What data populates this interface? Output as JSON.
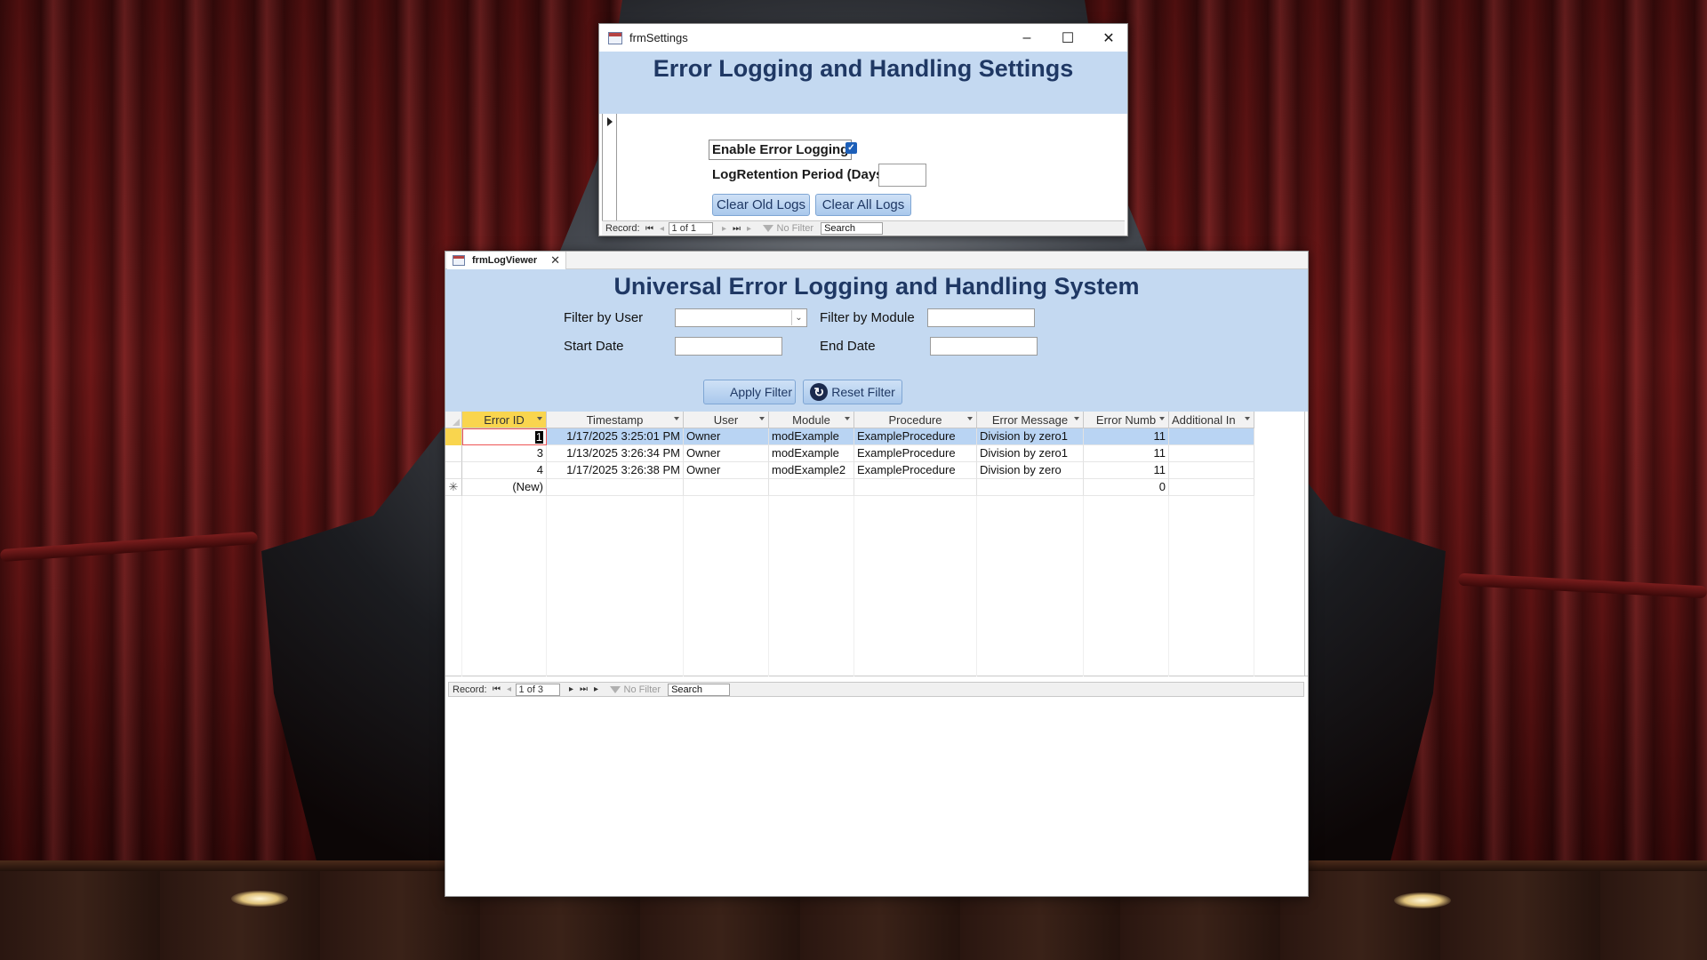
{
  "settings": {
    "window_title": "frmSettings",
    "header_title": "Error Logging and Handling Settings",
    "enable_label": "Enable Error Logging",
    "enable_checked": true,
    "retention_label": "LogRetention Period (Days)",
    "retention_value": "",
    "clear_old_label": "Clear Old Logs",
    "clear_all_label": "Clear All Logs",
    "nav": {
      "record_label": "Record:",
      "record_value": "1 of 1",
      "filter_label": "No Filter",
      "search_label": "Search"
    }
  },
  "viewer": {
    "tab_title": "frmLogViewer",
    "header_title": "Universal Error Logging and Handling System",
    "filter_user_label": "Filter by User",
    "filter_module_label": "Filter by Module",
    "start_date_label": "Start Date",
    "end_date_label": "End Date",
    "apply_label": "Apply Filter",
    "reset_label": "Reset Filter",
    "columns": [
      "Error ID",
      "Timestamp",
      "User",
      "Module",
      "Procedure",
      "Error Message",
      "Error Numb",
      "Additional In"
    ],
    "rows": [
      {
        "id": "1",
        "timestamp": "1/17/2025 3:25:01 PM",
        "user": "Owner",
        "module": "modExample",
        "procedure": "ExampleProcedure",
        "message": "Division by zero1",
        "number": "11",
        "extra": ""
      },
      {
        "id": "3",
        "timestamp": "1/13/2025 3:26:34 PM",
        "user": "Owner",
        "module": "modExample",
        "procedure": "ExampleProcedure",
        "message": "Division by zero1",
        "number": "11",
        "extra": ""
      },
      {
        "id": "4",
        "timestamp": "1/17/2025 3:26:38 PM",
        "user": "Owner",
        "module": "modExample2",
        "procedure": "ExampleProcedure",
        "message": "Division by zero",
        "number": "11",
        "extra": ""
      }
    ],
    "new_row": {
      "id": "(New)",
      "number": "0",
      "marker": "✳"
    },
    "nav": {
      "record_label": "Record:",
      "record_value": "1 of 3",
      "filter_label": "No Filter",
      "search_label": "Search"
    }
  }
}
